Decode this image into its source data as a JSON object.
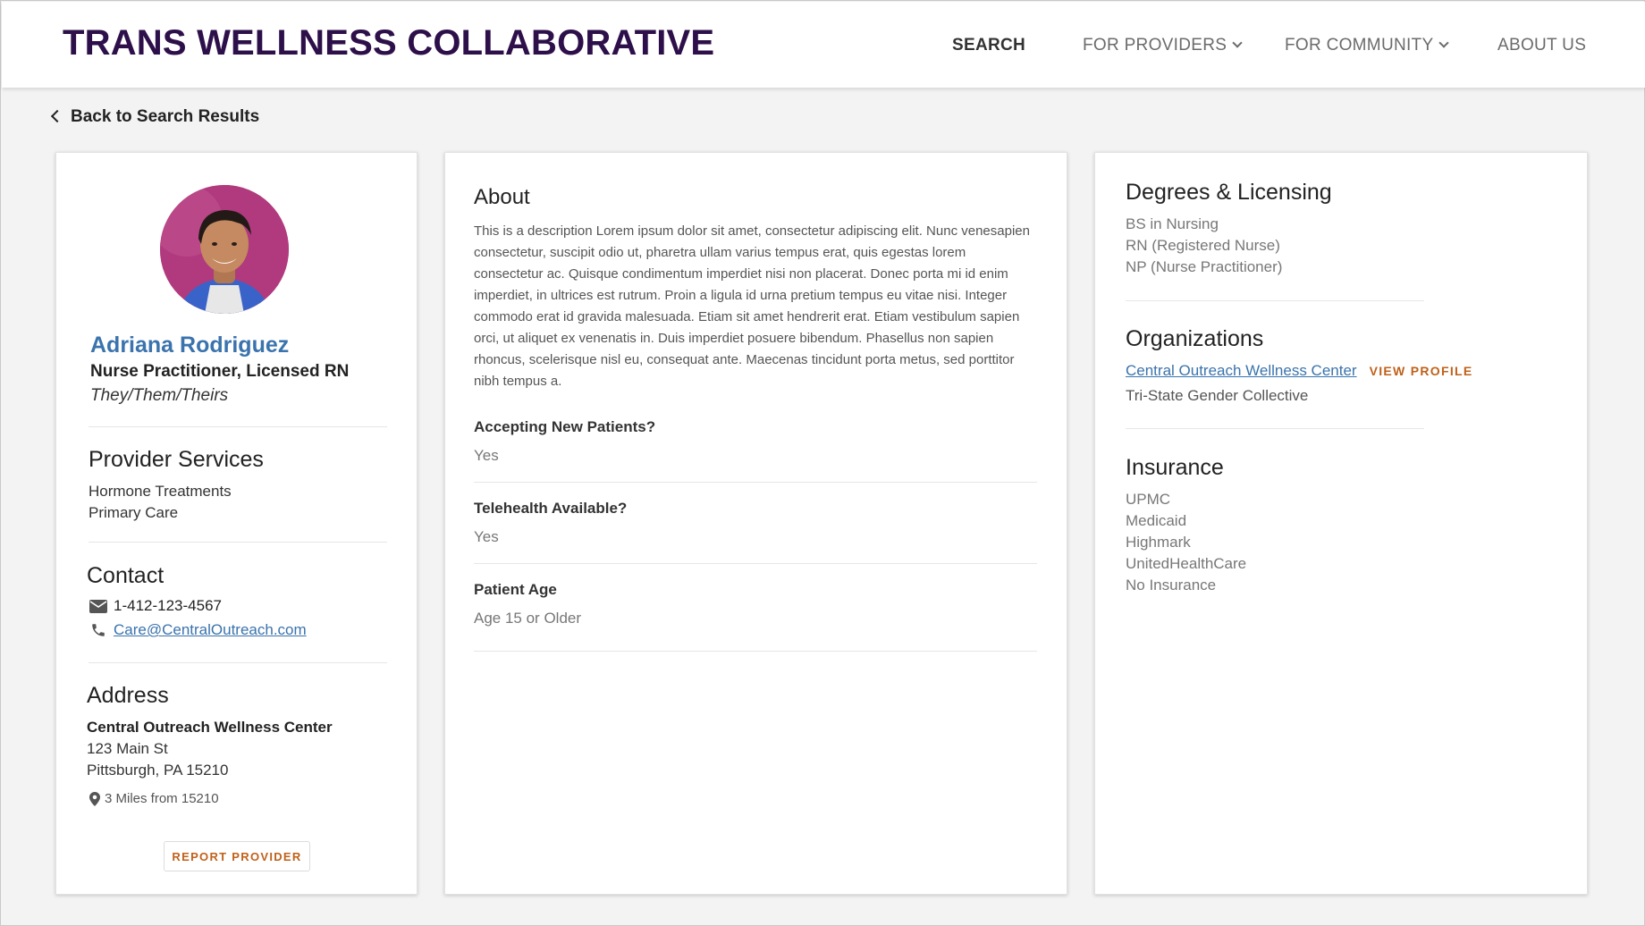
{
  "header": {
    "brand": "TRANS WELLNESS COLLABORATIVE",
    "nav": {
      "search": "SEARCH",
      "providers": "FOR PROVIDERS",
      "community": "FOR COMMUNITY",
      "about": "ABOUT US"
    }
  },
  "back_label": "Back to Search Results",
  "provider": {
    "name": "Adriana Rodriguez",
    "title": "Nurse Practitioner, Licensed RN",
    "pronouns": "They/Them/Theirs",
    "services_title": "Provider Services",
    "services": [
      "Hormone Treatments",
      "Primary Care"
    ],
    "contact_title": "Contact",
    "phone": "1-412-123-4567",
    "email": "Care@CentralOutreach.com",
    "address_title": "Address",
    "address_org": "Central Outreach Wellness Center",
    "address_street": "123 Main St",
    "address_city": "Pittsburgh, PA 15210",
    "distance": "3 Miles from 15210",
    "report_label": "REPORT PROVIDER"
  },
  "about": {
    "title": "About",
    "description": "This is a description Lorem ipsum dolor sit amet, consectetur adipiscing elit. Nunc venesapien consectetur, suscipit odio ut, pharetra ullam varius tempus erat, quis egestas lorem consectetur ac. Quisque condimentum imperdiet nisi non placerat. Donec porta mi id enim imperdiet, in ultrices est rutrum. Proin a ligula id urna pretium tempus eu vitae nisi. Integer commodo erat id gravida malesuada. Etiam sit amet hendrerit erat. Etiam vestibulum sapien orci, ut aliquet ex venenatis in. Duis imperdiet posuere bibendum. Phasellus non sapien rhoncus, scelerisque nisl eu, consequat ante. Maecenas tincidunt porta metus, sed porttitor nibh tempus a.",
    "questions": [
      {
        "q": "Accepting New Patients?",
        "a": "Yes"
      },
      {
        "q": "Telehealth Available?",
        "a": "Yes"
      },
      {
        "q": "Patient Age",
        "a": "Age 15 or Older"
      }
    ]
  },
  "details": {
    "degrees_title": "Degrees & Licensing",
    "degrees": [
      "BS in Nursing",
      "RN (Registered Nurse)",
      "NP (Nurse Practitioner)"
    ],
    "orgs_title": "Organizations",
    "org_primary": "Central Outreach Wellness Center",
    "view_profile": "VIEW PROFILE",
    "org_secondary": "Tri-State Gender Collective",
    "insurance_title": "Insurance",
    "insurance": [
      "UPMC",
      "Medicaid",
      "Highmark",
      "UnitedHealthCare",
      "No Insurance"
    ]
  },
  "colors": {
    "brand": "#2d0f4a",
    "link": "#3a73ad",
    "accent": "#c0611a"
  }
}
